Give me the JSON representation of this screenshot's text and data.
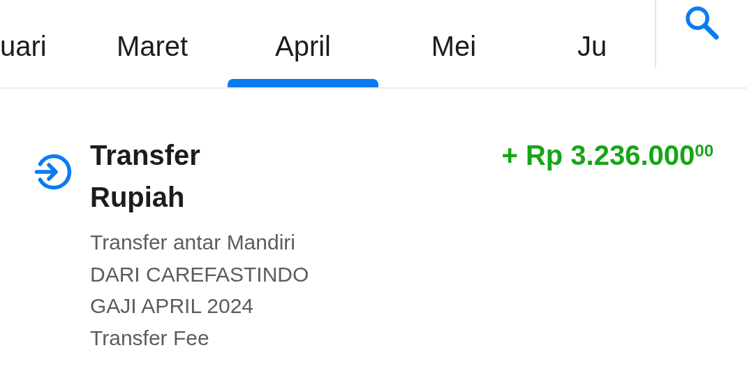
{
  "month_tabs": [
    {
      "label": "uari",
      "selected": false
    },
    {
      "label": "Maret",
      "selected": false
    },
    {
      "label": "April",
      "selected": true
    },
    {
      "label": "Mei",
      "selected": false
    },
    {
      "label": "Ju",
      "selected": false
    }
  ],
  "transaction": {
    "title": "Transfer Rupiah",
    "description": [
      "Transfer antar Mandiri",
      "DARI CAREFASTINDO",
      "GAJI APRIL 2024",
      "Transfer Fee"
    ],
    "amount": "+ Rp 3.236.000$^{00}$"
  }
}
